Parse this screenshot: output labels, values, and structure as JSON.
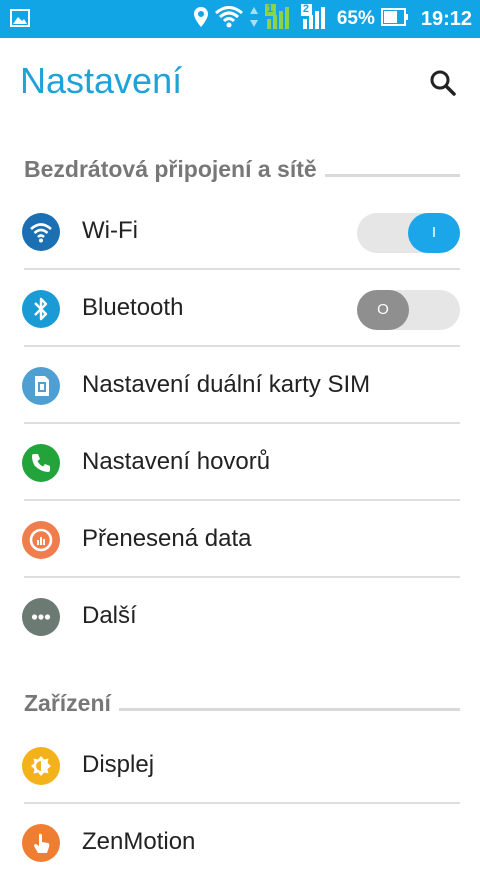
{
  "status_bar": {
    "battery": "65%",
    "time": "19:12",
    "sim1_label": "1",
    "sim2_label": "2"
  },
  "header": {
    "title": "Nastavení"
  },
  "sections": {
    "wireless": "Bezdrátová připojení a sítě",
    "device": "Zařízení"
  },
  "items": {
    "wifi": {
      "label": "Wi-Fi",
      "toggle_text": "I",
      "state": "on"
    },
    "bluetooth": {
      "label": "Bluetooth",
      "toggle_text": "O",
      "state": "off"
    },
    "dual_sim": {
      "label": "Nastavení duální karty SIM"
    },
    "calls": {
      "label": "Nastavení hovorů"
    },
    "data": {
      "label": "Přenesená data"
    },
    "more": {
      "label": "Další"
    },
    "display": {
      "label": "Displej"
    },
    "zenmotion": {
      "label": "ZenMotion"
    }
  },
  "colors": {
    "status_bar": "#12a5e6",
    "title": "#1ea3d8",
    "toggle_on": "#1aa6e8",
    "toggle_off": "#8f8f8f"
  }
}
